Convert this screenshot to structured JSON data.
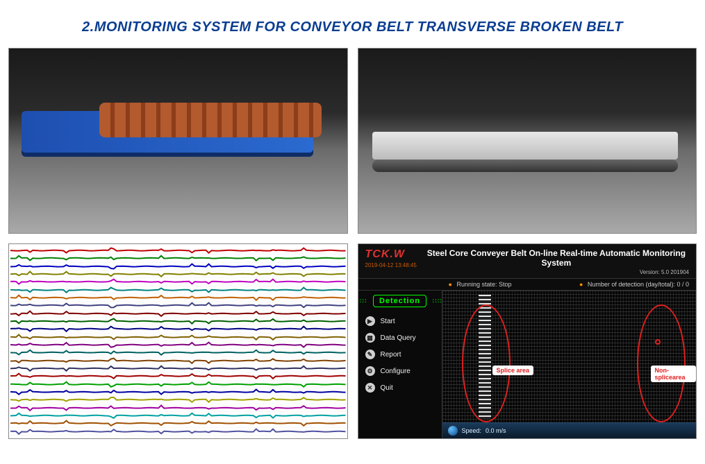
{
  "page_title": "2.MONITORING SYSTEM FOR CONVEYOR BELT TRANSVERSE BROKEN BELT",
  "waveform": {
    "trace_colors": [
      "#c00000",
      "#008000",
      "#0000c0",
      "#808000",
      "#c000c0",
      "#008080",
      "#c06000",
      "#404080",
      "#800000",
      "#006000",
      "#000080",
      "#806000",
      "#800080",
      "#006060",
      "#804000",
      "#303060",
      "#a00000",
      "#00a000",
      "#0000a0",
      "#a0a000",
      "#a000a0",
      "#00a0a0",
      "#a05000",
      "#5050a0"
    ]
  },
  "monitor": {
    "logo": "TCK.W",
    "timestamp": "2019-04-12 13:48:45",
    "title": "Steel Core Conveyer Belt On-line Real-time Automatic Monitoring System",
    "version": "Version: 5.0 201904",
    "status_running_label": "Running state:",
    "status_running_value": "Stop",
    "status_count_label": "Number of detection (day/total):",
    "status_count_value": "0 / 0",
    "section_label": "Detection",
    "menu": [
      {
        "icon": "▶",
        "label": "Start"
      },
      {
        "icon": "▦",
        "label": "Data Query"
      },
      {
        "icon": "✎",
        "label": "Report"
      },
      {
        "icon": "⚙",
        "label": "Configure"
      },
      {
        "icon": "✕",
        "label": "Quit"
      }
    ],
    "annotation_splice": "Splice area",
    "annotation_nonsplice": "Non-splicearea",
    "footer_speed_label": "Speed:",
    "footer_speed_value": "0.0 m/s"
  }
}
